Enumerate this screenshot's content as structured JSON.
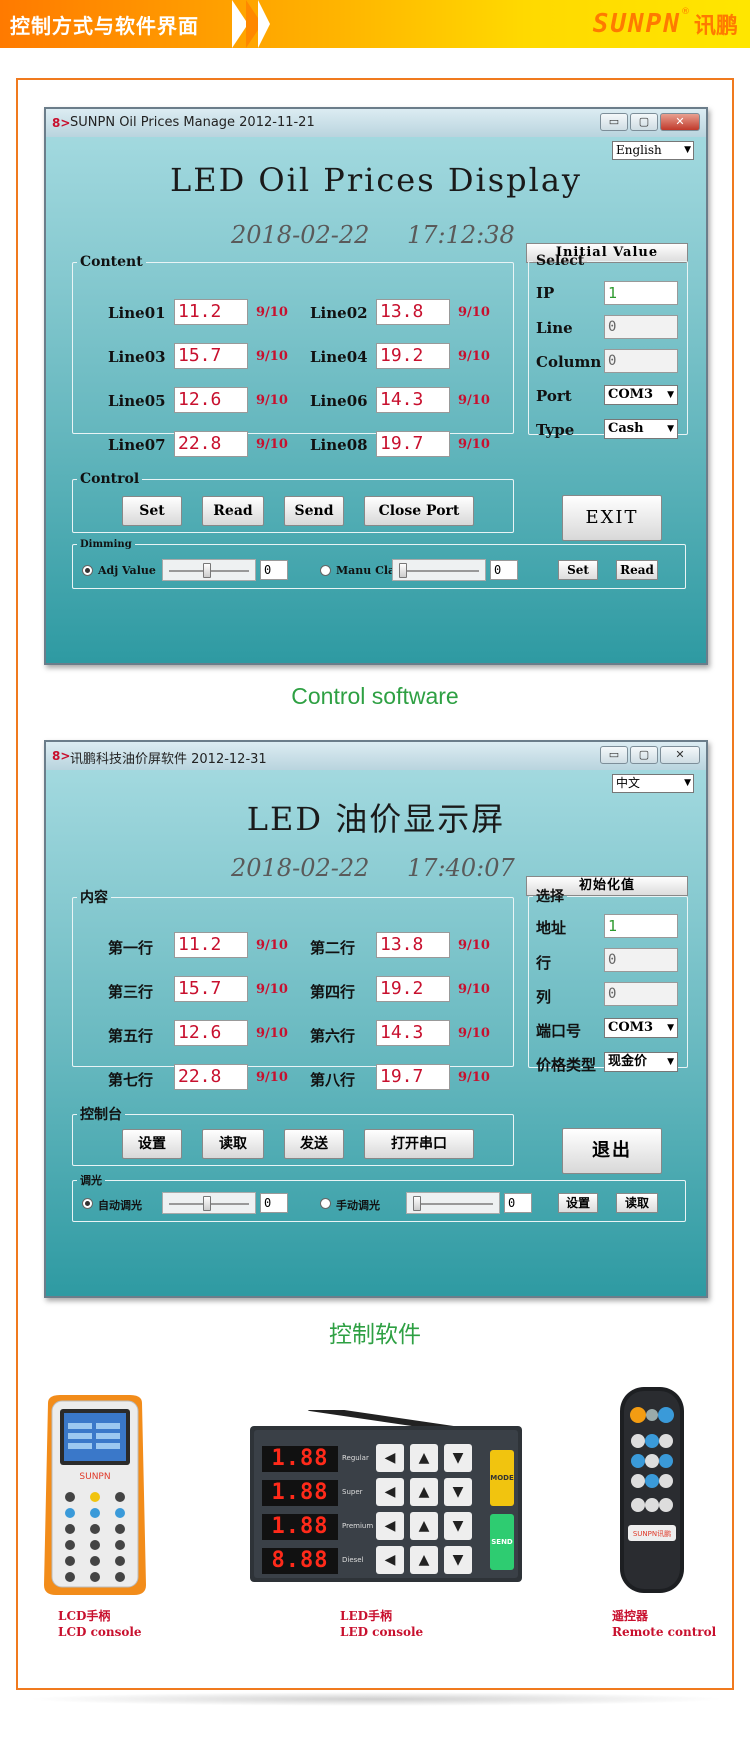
{
  "banner": {
    "title": "控制方式与软件界面",
    "logo_en": "SUNPN",
    "logo_reg": "®",
    "logo_cn": "讯鹏"
  },
  "en_window": {
    "title": "SUNPN Oil Prices Manage 2012-11-21",
    "lang": "English",
    "heading": "LED  Oil  Prices  Display",
    "date": "2018-02-22",
    "time": "17:12:38",
    "init_button": "Initial Value",
    "content_legend": "Content",
    "lines": [
      {
        "name": "Line01",
        "value": "11.2",
        "frac": "9/10"
      },
      {
        "name": "Line02",
        "value": "13.8",
        "frac": "9/10"
      },
      {
        "name": "Line03",
        "value": "15.7",
        "frac": "9/10"
      },
      {
        "name": "Line04",
        "value": "19.2",
        "frac": "9/10"
      },
      {
        "name": "Line05",
        "value": "12.6",
        "frac": "9/10"
      },
      {
        "name": "Line06",
        "value": "14.3",
        "frac": "9/10"
      },
      {
        "name": "Line07",
        "value": "22.8",
        "frac": "9/10"
      },
      {
        "name": "Line08",
        "value": "19.7",
        "frac": "9/10"
      }
    ],
    "select_legend": "Select",
    "ip_label": "IP",
    "ip_value": "1",
    "line_label": "Line",
    "line_value": "0",
    "column_label": "Column",
    "column_value": "0",
    "port_label": "Port",
    "port_value": "COM3",
    "type_label": "Type",
    "type_value": "Cash",
    "control_legend": "Control",
    "btn_set": "Set",
    "btn_read": "Read",
    "btn_send": "Send",
    "btn_port": "Close Port",
    "exit": "EXIT",
    "dimming_legend": "Dimming",
    "adj_label": "Adj Value",
    "adj_value": "0",
    "manu_label": "Manu Class",
    "manu_value": "0",
    "dim_set": "Set",
    "dim_read": "Read"
  },
  "cn_window": {
    "title": "讯鹏科技油价屏软件 2012-12-31",
    "lang": "中文",
    "heading": "LED  油价显示屏",
    "date": "2018-02-22",
    "time": "17:40:07",
    "init_button": "初始化值",
    "content_legend": "内容",
    "lines": [
      {
        "name": "第一行",
        "value": "11.2",
        "frac": "9/10"
      },
      {
        "name": "第二行",
        "value": "13.8",
        "frac": "9/10"
      },
      {
        "name": "第三行",
        "value": "15.7",
        "frac": "9/10"
      },
      {
        "name": "第四行",
        "value": "19.2",
        "frac": "9/10"
      },
      {
        "name": "第五行",
        "value": "12.6",
        "frac": "9/10"
      },
      {
        "name": "第六行",
        "value": "14.3",
        "frac": "9/10"
      },
      {
        "name": "第七行",
        "value": "22.8",
        "frac": "9/10"
      },
      {
        "name": "第八行",
        "value": "19.7",
        "frac": "9/10"
      }
    ],
    "select_legend": "选择",
    "ip_label": "地址",
    "ip_value": "1",
    "line_label": "行",
    "line_value": "0",
    "column_label": "列",
    "column_value": "0",
    "port_label": "端口号",
    "port_value": "COM3",
    "type_label": "价格类型",
    "type_value": "现金价",
    "control_legend": "控制台",
    "btn_set": "设置",
    "btn_read": "读取",
    "btn_send": "发送",
    "btn_port": "打开串口",
    "exit": "退出",
    "dimming_legend": "调光",
    "adj_label": "自动调光",
    "adj_value": "0",
    "manu_label": "手动调光",
    "manu_value": "0",
    "dim_set": "设置",
    "dim_read": "读取"
  },
  "captions": {
    "en": "Control software",
    "cn": "控制软件"
  },
  "devices": {
    "lcd_cn": "LCD手柄",
    "lcd_en": "LCD console",
    "led_cn": "LED手柄",
    "led_en": "LED console",
    "remote_cn": "遥控器",
    "remote_en": "Remote control",
    "panel_rows": [
      {
        "digits": "1.88",
        "label": "Regular"
      },
      {
        "digits": "1.88",
        "label": "Super"
      },
      {
        "digits": "1.88",
        "label": "Premium"
      },
      {
        "digits": "8.88",
        "label": "Diesel"
      }
    ],
    "mode_label": "MODE",
    "send_label": "SEND",
    "handset_brand": "SUNPN",
    "remote_brand": "SUNPN讯鹏"
  },
  "colors": {
    "accent_orange": "#f07a1e",
    "value_red": "#c8102e",
    "caption_green": "#2ea043"
  }
}
